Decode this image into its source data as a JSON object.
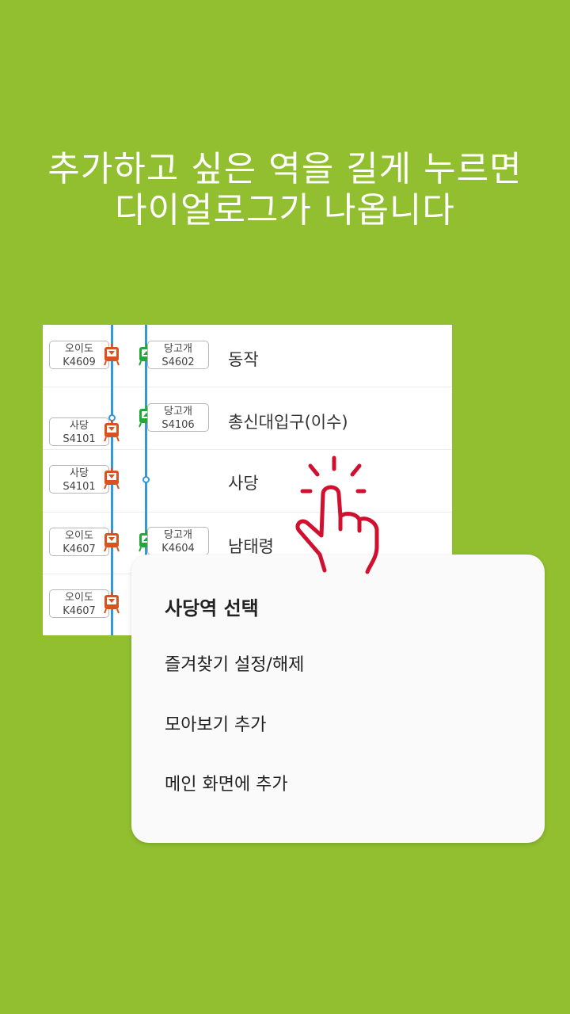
{
  "headline": {
    "line1": "추가하고 싶은 역을 길게 누르면",
    "line2": "다이얼로그가 나옵니다"
  },
  "stations": [
    {
      "name": "동작",
      "left_tag": [
        "오이도",
        "K4609"
      ],
      "right_tag": [
        "당고개",
        "S4602"
      ]
    },
    {
      "name": "총신대입구(이수)",
      "left_tag": [
        "사당",
        "S4101"
      ],
      "right_tag": [
        "당고개",
        "S4106"
      ]
    },
    {
      "name": "사당",
      "left_tag": [
        "사당",
        "S4101"
      ],
      "right_tag": null
    },
    {
      "name": "남태령",
      "left_tag": [
        "오이도",
        "K4607"
      ],
      "right_tag": [
        "당고개",
        "K4604"
      ]
    },
    {
      "name": "",
      "left_tag": [
        "오이도",
        "K4607"
      ],
      "right_tag": null
    }
  ],
  "colors": {
    "background": "#91bf2f",
    "line": "#3399d8",
    "down_train": "#d9531e",
    "up_train": "#22a83a",
    "hand": "#d0102f"
  },
  "icons": {
    "down_train": "train-down-icon",
    "up_train": "train-up-icon",
    "hand": "tap-hand-icon"
  },
  "dialog": {
    "title": "사당역 선택",
    "items": [
      "즐겨찾기 설정/해제",
      "모아보기 추가",
      "메인 화면에 추가"
    ]
  }
}
